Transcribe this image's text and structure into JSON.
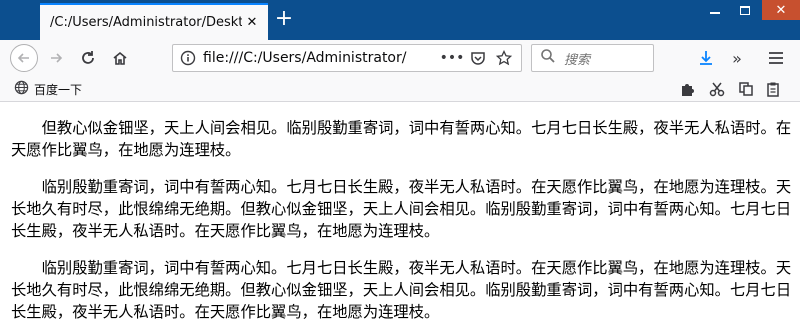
{
  "browser": {
    "tab_title": "/C:/Users/Administrator/Desktop",
    "url": "file:///C:/Users/Administrator/",
    "search_placeholder": "搜索",
    "bookmark_label": "百度一下"
  },
  "content": {
    "paragraphs": [
      "但教心似金钿坚，天上人间会相见。临别殷勤重寄词，词中有誓两心知。七月七日长生殿，夜半无人私语时。在天愿作比翼鸟，在地愿为连理枝。",
      "临别殷勤重寄词，词中有誓两心知。七月七日长生殿，夜半无人私语时。在天愿作比翼鸟，在地愿为连理枝。天长地久有时尽，此恨绵绵无绝期。但教心似金钿坚，天上人间会相见。临别殷勤重寄词，词中有誓两心知。七月七日长生殿，夜半无人私语时。在天愿作比翼鸟，在地愿为连理枝。",
      "临别殷勤重寄词，词中有誓两心知。七月七日长生殿，夜半无人私语时。在天愿作比翼鸟，在地愿为连理枝。天长地久有时尽，此恨绵绵无绝期。但教心似金钿坚，天上人间会相见。临别殷勤重寄词，词中有誓两心知。七月七日长生殿，夜半无人私语时。在天愿作比翼鸟，在地愿为连理枝。"
    ]
  },
  "icons": [
    "back-icon",
    "forward-icon",
    "reload-icon",
    "home-icon",
    "info-icon",
    "more-icon",
    "pocket-icon",
    "bookmark-star-icon",
    "search-icon",
    "download-icon",
    "overflow-icon",
    "menu-icon",
    "globe-icon",
    "extension-icon",
    "cut-icon",
    "copy-icon",
    "paste-icon"
  ],
  "colors": {
    "titlebar": "#0c4f8f",
    "tab_accent": "#0a84ff",
    "close_button": "#c7502f",
    "download_accent": "#0a84ff"
  }
}
